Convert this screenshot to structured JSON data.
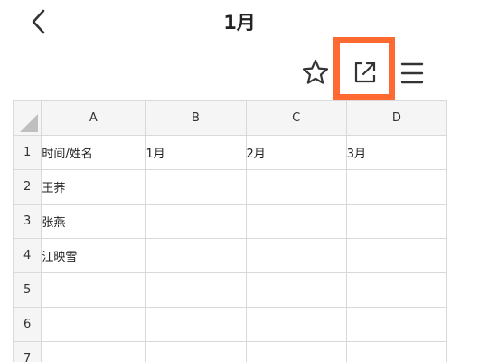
{
  "header": {
    "title": "1月"
  },
  "toolbar": {
    "icons": [
      "star-icon",
      "share-export-icon",
      "menu-icon"
    ]
  },
  "sheet": {
    "columns": [
      "A",
      "B",
      "C",
      "D"
    ],
    "rows": [
      {
        "num": "1",
        "cells": [
          "时间/姓名",
          "1月",
          "2月",
          "3月"
        ]
      },
      {
        "num": "2",
        "cells": [
          "王荞",
          "",
          "",
          ""
        ]
      },
      {
        "num": "3",
        "cells": [
          "张燕",
          "",
          "",
          ""
        ]
      },
      {
        "num": "4",
        "cells": [
          "江映雪",
          "",
          "",
          ""
        ]
      },
      {
        "num": "5",
        "cells": [
          "",
          "",
          "",
          ""
        ]
      },
      {
        "num": "6",
        "cells": [
          "",
          "",
          "",
          ""
        ]
      },
      {
        "num": "7",
        "cells": [
          "",
          "",
          "",
          ""
        ]
      }
    ]
  },
  "colors": {
    "highlight": "#ff6a33",
    "gridline": "#d9d9d9",
    "header_bg": "#f5f5f5"
  }
}
